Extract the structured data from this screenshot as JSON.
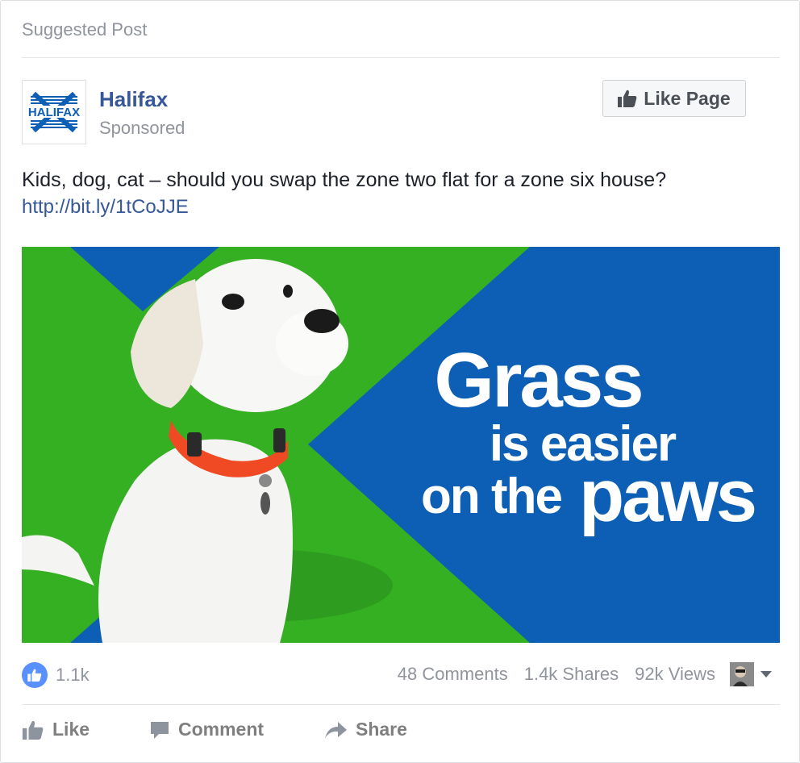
{
  "post": {
    "suggested_label": "Suggested Post",
    "page_name": "Halifax",
    "logo_text": "HALIFAX",
    "sponsored_label": "Sponsored",
    "like_page_label": "Like Page",
    "text": "Kids, dog, cat – should you swap the zone two flat for a zone six house?",
    "link": "http://bit.ly/1tCoJJE"
  },
  "ad_image": {
    "line1": "Grass",
    "line2": "is easier",
    "line3a": "on the",
    "line3b": "paws",
    "colors": {
      "green": "#35b023",
      "blue": "#0d5fb5",
      "collar": "#ef4a23"
    }
  },
  "stats": {
    "likes": "1.1k",
    "comments": "48 Comments",
    "shares": "1.4k Shares",
    "views": "92k Views"
  },
  "actions": {
    "like": "Like",
    "comment": "Comment",
    "share": "Share"
  },
  "icons": [
    "thumbs-up-icon",
    "speech-bubble-icon",
    "share-arrow-icon",
    "chevron-down-icon"
  ],
  "colors": {
    "link": "#365899",
    "like_circle": "#5890ff",
    "muted": "#90949c"
  }
}
